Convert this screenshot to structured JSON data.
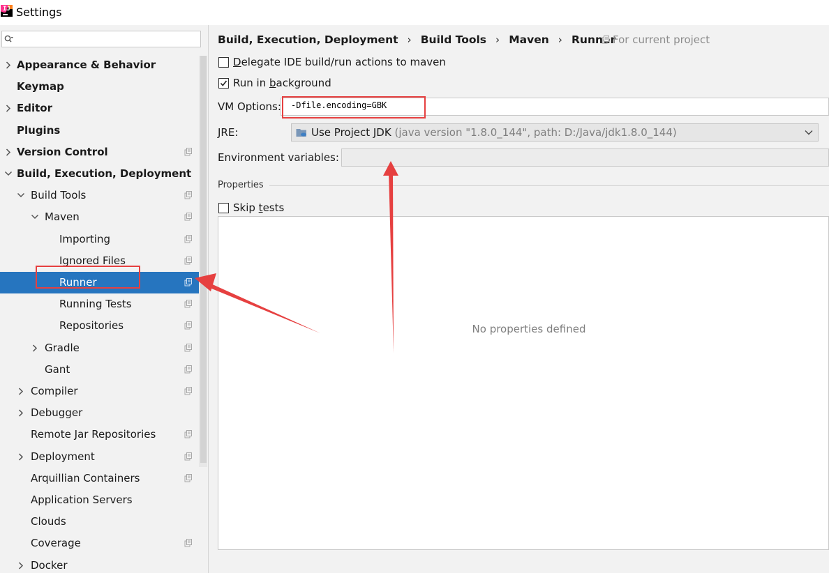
{
  "window": {
    "title": "Settings"
  },
  "sidebar": {
    "search": {
      "placeholder": "",
      "value": ""
    },
    "items": [
      {
        "label": "Appearance & Behavior",
        "level": 0,
        "bold": true,
        "arrow": "right",
        "proj": false
      },
      {
        "label": "Keymap",
        "level": 0,
        "bold": true,
        "arrow": "none",
        "proj": false
      },
      {
        "label": "Editor",
        "level": 0,
        "bold": true,
        "arrow": "right",
        "proj": false
      },
      {
        "label": "Plugins",
        "level": 0,
        "bold": true,
        "arrow": "none",
        "proj": false
      },
      {
        "label": "Version Control",
        "level": 0,
        "bold": true,
        "arrow": "right",
        "proj": true
      },
      {
        "label": "Build, Execution, Deployment",
        "level": 0,
        "bold": true,
        "arrow": "down",
        "proj": false
      },
      {
        "label": "Build Tools",
        "level": 1,
        "bold": false,
        "arrow": "down",
        "proj": true
      },
      {
        "label": "Maven",
        "level": 2,
        "bold": false,
        "arrow": "down",
        "proj": true
      },
      {
        "label": "Importing",
        "level": 3,
        "bold": false,
        "arrow": "none",
        "proj": true
      },
      {
        "label": "Ignored Files",
        "level": 3,
        "bold": false,
        "arrow": "none",
        "proj": true
      },
      {
        "label": "Runner",
        "level": 3,
        "bold": false,
        "arrow": "none",
        "proj": true,
        "selected": true
      },
      {
        "label": "Running Tests",
        "level": 3,
        "bold": false,
        "arrow": "none",
        "proj": true
      },
      {
        "label": "Repositories",
        "level": 3,
        "bold": false,
        "arrow": "none",
        "proj": true
      },
      {
        "label": "Gradle",
        "level": 2,
        "bold": false,
        "arrow": "right",
        "proj": true
      },
      {
        "label": "Gant",
        "level": 2,
        "bold": false,
        "arrow": "none",
        "proj": true
      },
      {
        "label": "Compiler",
        "level": 1,
        "bold": false,
        "arrow": "right",
        "proj": true
      },
      {
        "label": "Debugger",
        "level": 1,
        "bold": false,
        "arrow": "right",
        "proj": false
      },
      {
        "label": "Remote Jar Repositories",
        "level": 1,
        "bold": false,
        "arrow": "none",
        "proj": true
      },
      {
        "label": "Deployment",
        "level": 1,
        "bold": false,
        "arrow": "right",
        "proj": true
      },
      {
        "label": "Arquillian Containers",
        "level": 1,
        "bold": false,
        "arrow": "none",
        "proj": true
      },
      {
        "label": "Application Servers",
        "level": 1,
        "bold": false,
        "arrow": "none",
        "proj": false
      },
      {
        "label": "Clouds",
        "level": 1,
        "bold": false,
        "arrow": "none",
        "proj": false
      },
      {
        "label": "Coverage",
        "level": 1,
        "bold": false,
        "arrow": "none",
        "proj": true
      },
      {
        "label": "Docker",
        "level": 1,
        "bold": false,
        "arrow": "right",
        "proj": false
      }
    ]
  },
  "breadcrumb": [
    "Build, Execution, Deployment",
    "Build Tools",
    "Maven",
    "Runner"
  ],
  "breadcrumb_separator": "›",
  "scope_label": "For current project",
  "options": {
    "delegate": {
      "label_pre": "",
      "label_ul": "D",
      "label_post": "elegate IDE build/run actions to maven",
      "checked": false
    },
    "background": {
      "label_pre": "Run in ",
      "label_ul": "b",
      "label_post": "ackground",
      "checked": true
    },
    "vm_options": {
      "label": "VM Options:",
      "value": "-Dfile.encoding=GBK"
    },
    "jre": {
      "label": "JRE:",
      "value": "Use Project JDK",
      "hint": "(java version \"1.8.0_144\", path: D:/Java/jdk1.8.0_144)"
    },
    "env": {
      "label": "Environment variables:",
      "value": ""
    }
  },
  "properties": {
    "title": "Properties",
    "skip_tests": {
      "label_pre": "Skip ",
      "label_ul": "t",
      "label_post": "ests",
      "checked": false
    },
    "empty_text": "No properties defined"
  },
  "colors": {
    "selection": "#2675bf",
    "annotation": "#e64040",
    "panel_bg": "#f2f2f2"
  }
}
